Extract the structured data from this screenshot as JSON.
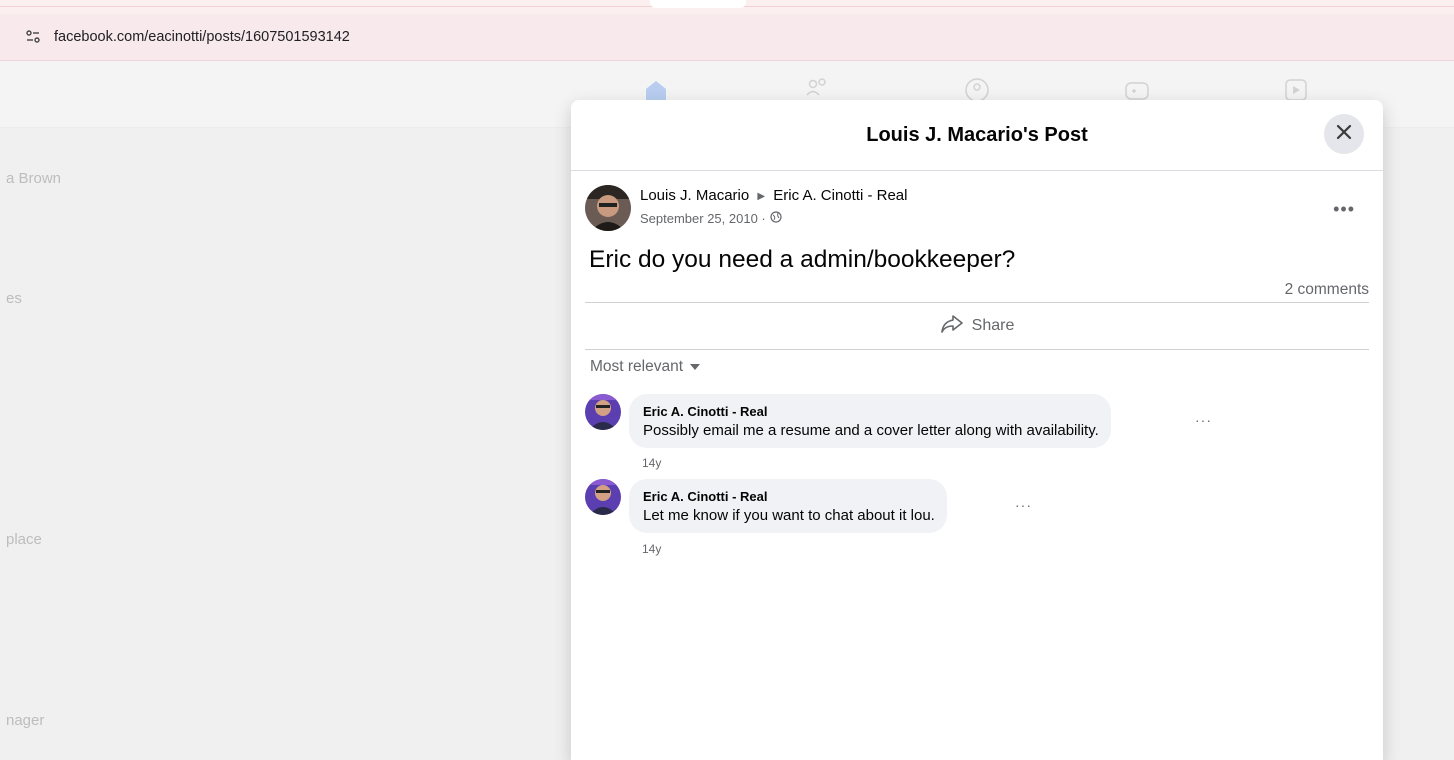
{
  "browser": {
    "url": "facebook.com/eacinotti/posts/1607501593142"
  },
  "background": {
    "sidebar_fragments": [
      "a Brown",
      "es",
      "place",
      "nager"
    ]
  },
  "modal": {
    "title": "Louis J. Macario's Post",
    "post": {
      "author": "Louis J. Macario",
      "target": "Eric A. Cinotti - Real",
      "date": "September 25, 2010 ·",
      "text": "Eric do you need a admin/bookkeeper?",
      "comment_count": "2 comments",
      "share_label": "Share"
    },
    "sort_label": "Most relevant",
    "comments": [
      {
        "author": "Eric A. Cinotti - Real",
        "text": "Possibly email me a resume and a cover letter along with availability.",
        "time": "14y"
      },
      {
        "author": "Eric A. Cinotti - Real",
        "text": "Let me know if you want to chat about it lou.",
        "time": "14y"
      }
    ]
  },
  "colors": {
    "address_bar": "#f7e9ec",
    "modal_bg": "#ffffff",
    "comment_bubble": "#f0f2f5",
    "secondary_text": "#65676b",
    "nav_home_active": "#1877f2"
  },
  "icons": [
    "site-info-icon",
    "close-icon",
    "more-icon",
    "globe-icon",
    "share-icon",
    "caret-down-icon",
    "home-icon",
    "friends-icon",
    "groups-icon",
    "gaming-icon",
    "watch-icon"
  ]
}
